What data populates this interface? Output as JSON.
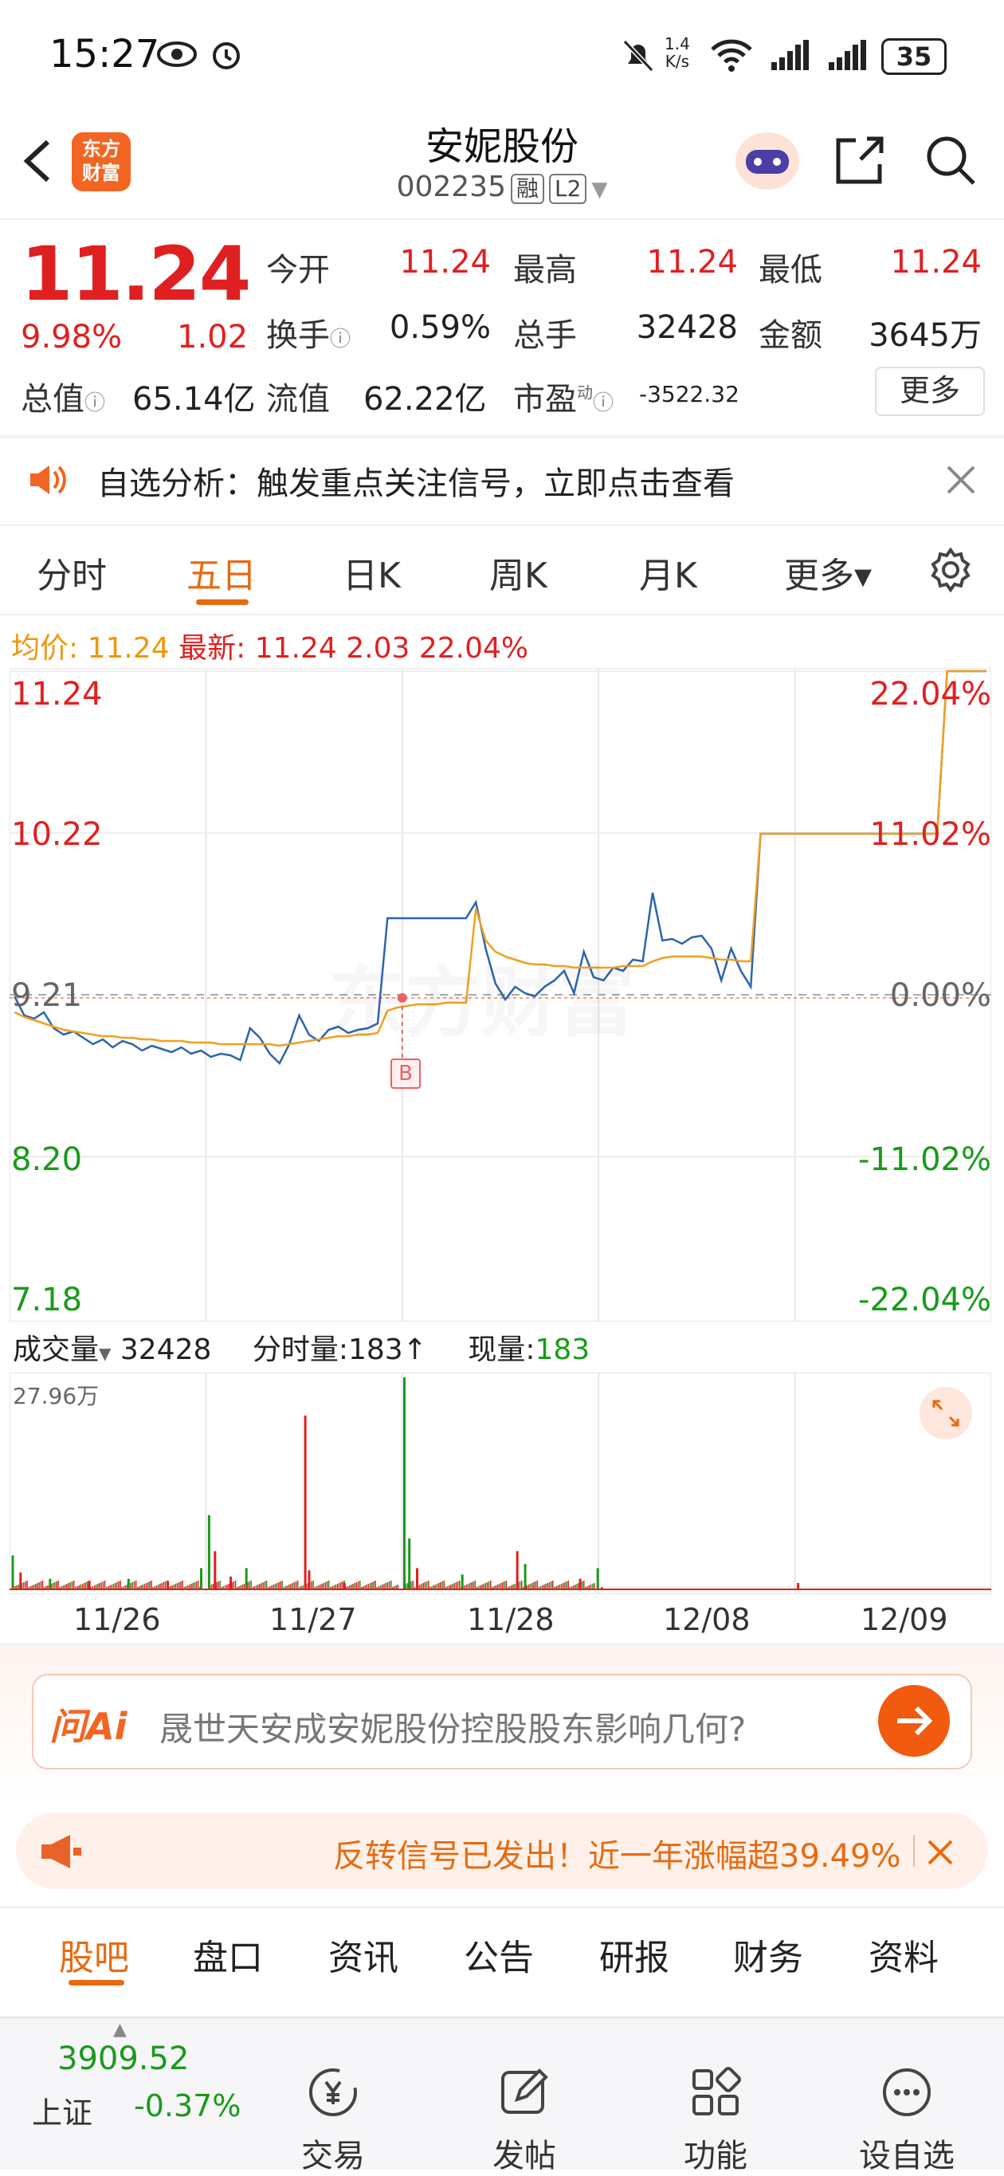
{
  "status_bar": {
    "time": "15:27",
    "net_speed_top": "1.4",
    "net_speed_bottom": "K/s",
    "battery": "35"
  },
  "header": {
    "logo_line1": "东方",
    "logo_line2": "财富",
    "title": "安妮股份",
    "code": "002235",
    "badge_rong": "融",
    "badge_l2": "L2"
  },
  "quote": {
    "price": "11.24",
    "change_pct": "9.98%",
    "change": "1.02",
    "open_label": "今开",
    "open": "11.24",
    "high_label": "最高",
    "high": "11.24",
    "low_label": "最低",
    "low": "11.24",
    "turnover_label": "换手",
    "turnover": "0.59%",
    "volume_label": "总手",
    "volume": "32428",
    "amount_label": "金额",
    "amount": "3645万",
    "mktcap_label": "总值",
    "mktcap": "65.14亿",
    "float_label": "流值",
    "float": "62.22亿",
    "pe_label": "市盈",
    "pe_sup": "动",
    "pe": "-3522.32",
    "more_label": "更多"
  },
  "notice": {
    "text": "自选分析：触发重点关注信号，立即点击查看"
  },
  "tabs": [
    "分时",
    "五日",
    "日K",
    "周K",
    "月K",
    "更多▾"
  ],
  "chart_info": {
    "avg_label": "均价:",
    "avg": "11.24",
    "latest_label": "最新:",
    "latest": "11.24",
    "chg": "2.03",
    "chg_pct": "22.04%"
  },
  "chart_data": {
    "type": "line",
    "title": "",
    "xlabel": "",
    "ylabel": "",
    "x": [
      "11/26",
      "11/27",
      "11/28",
      "12/08",
      "12/09"
    ],
    "ylim": [
      7.18,
      11.24
    ],
    "y_ticks_left": [
      "11.24",
      "10.22",
      "9.21",
      "8.20",
      "7.18"
    ],
    "y_ticks_right": [
      "22.04%",
      "11.02%",
      "0.00%",
      "-11.02%",
      "-22.04%"
    ],
    "prev_close": 9.21,
    "series": [
      {
        "values": [
          9.2,
          9.08,
          9.06,
          9.1,
          9.0,
          8.96,
          8.98,
          8.94,
          8.9,
          8.93,
          8.88,
          8.92,
          8.9,
          8.86,
          8.89,
          8.87,
          8.85,
          8.88,
          8.84,
          8.86,
          8.82,
          8.84,
          8.83,
          8.8,
          9.0,
          8.94,
          8.84,
          8.78,
          8.9,
          9.08,
          8.96,
          8.92,
          8.99,
          9.01,
          8.97,
          8.99,
          9.0,
          9.03,
          9.69,
          9.69,
          9.69,
          9.69,
          9.69,
          9.69,
          9.69,
          9.69,
          9.69,
          9.79,
          9.5,
          9.28,
          9.18,
          9.26,
          9.22,
          9.2,
          9.26,
          9.3,
          9.36,
          9.22,
          9.48,
          9.32,
          9.3,
          9.38,
          9.36,
          9.43,
          9.42,
          9.85,
          9.55,
          9.56,
          9.53,
          9.57,
          9.58,
          9.5,
          9.3,
          9.5,
          9.36,
          9.26,
          10.22,
          10.22,
          10.22,
          10.22,
          10.22,
          10.22,
          10.22,
          10.22,
          10.22,
          10.22,
          10.22,
          10.22,
          10.22,
          10.22,
          10.22,
          10.22,
          10.22,
          10.22,
          10.22,
          11.24,
          11.24,
          11.24,
          11.24,
          11.24
        ]
      },
      {
        "values": [
          9.1,
          9.07,
          9.05,
          9.03,
          9.01,
          8.99,
          8.98,
          8.97,
          8.96,
          8.95,
          8.95,
          8.94,
          8.94,
          8.93,
          8.93,
          8.92,
          8.92,
          8.92,
          8.91,
          8.91,
          8.91,
          8.9,
          8.9,
          8.9,
          8.9,
          8.9,
          8.9,
          8.89,
          8.9,
          8.91,
          8.92,
          8.93,
          8.94,
          8.95,
          8.95,
          8.96,
          8.96,
          8.97,
          9.11,
          9.13,
          9.14,
          9.15,
          9.15,
          9.15,
          9.16,
          9.16,
          9.16,
          9.75,
          9.55,
          9.48,
          9.45,
          9.43,
          9.41,
          9.4,
          9.4,
          9.39,
          9.39,
          9.38,
          9.38,
          9.38,
          9.38,
          9.38,
          9.39,
          9.39,
          9.39,
          9.42,
          9.44,
          9.45,
          9.45,
          9.45,
          9.45,
          9.44,
          9.43,
          9.43,
          9.42,
          9.42,
          10.22,
          10.22,
          10.22,
          10.22,
          10.22,
          10.22,
          10.22,
          10.22,
          10.22,
          10.22,
          10.22,
          10.22,
          10.22,
          10.22,
          10.22,
          10.22,
          10.22,
          10.22,
          10.22,
          11.24,
          11.24,
          11.24,
          11.24,
          11.24
        ]
      }
    ],
    "volume_max_label": "27.96万",
    "volume": [
      {
        "d": 0,
        "t": 0.01,
        "v": 0.16,
        "c": "green"
      },
      {
        "d": 0,
        "t": 0.05,
        "v": 0.08,
        "c": "red"
      },
      {
        "d": 0,
        "t": 0.2,
        "v": 0.05,
        "c": "green"
      },
      {
        "d": 0,
        "t": 0.4,
        "v": 0.04,
        "c": "red"
      },
      {
        "d": 0,
        "t": 0.6,
        "v": 0.05,
        "c": "green"
      },
      {
        "d": 0,
        "t": 0.8,
        "v": 0.04,
        "c": "red"
      },
      {
        "d": 0,
        "t": 0.97,
        "v": 0.1,
        "c": "green"
      },
      {
        "d": 1,
        "t": 0.01,
        "v": 0.35,
        "c": "green"
      },
      {
        "d": 1,
        "t": 0.04,
        "v": 0.18,
        "c": "red"
      },
      {
        "d": 1,
        "t": 0.12,
        "v": 0.06,
        "c": "red"
      },
      {
        "d": 1,
        "t": 0.2,
        "v": 0.1,
        "c": "green"
      },
      {
        "d": 1,
        "t": 0.5,
        "v": 0.82,
        "c": "red"
      },
      {
        "d": 1,
        "t": 0.52,
        "v": 0.09,
        "c": "red"
      },
      {
        "d": 1,
        "t": 0.7,
        "v": 0.03,
        "c": "red"
      },
      {
        "d": 2,
        "t": 0.005,
        "v": 1.0,
        "c": "green"
      },
      {
        "d": 2,
        "t": 0.03,
        "v": 0.24,
        "c": "green"
      },
      {
        "d": 2,
        "t": 0.07,
        "v": 0.1,
        "c": "red"
      },
      {
        "d": 2,
        "t": 0.3,
        "v": 0.07,
        "c": "green"
      },
      {
        "d": 2,
        "t": 0.58,
        "v": 0.18,
        "c": "red"
      },
      {
        "d": 2,
        "t": 0.62,
        "v": 0.12,
        "c": "green"
      },
      {
        "d": 2,
        "t": 0.9,
        "v": 0.05,
        "c": "red"
      },
      {
        "d": 2,
        "t": 0.99,
        "v": 0.1,
        "c": "green"
      },
      {
        "d": 3,
        "t": 0.01,
        "v": 0.01,
        "c": "red"
      },
      {
        "d": 4,
        "t": 0.01,
        "v": 0.03,
        "c": "red"
      }
    ]
  },
  "volume_info": {
    "label": "成交量",
    "total": "32428",
    "tick_label": "分时量:183↑",
    "now_label": "现量:",
    "now": "183"
  },
  "marker_b": "B",
  "watermark": "东方财富",
  "ai": {
    "logo": "问Ai",
    "question": "晟世天安成安妮股份控股股东影响几何?"
  },
  "banner": {
    "text": "反转信号已发出！近一年涨幅超39.49%"
  },
  "bottom_tabs": [
    "股吧",
    "盘口",
    "资讯",
    "公告",
    "研报",
    "财务",
    "资料"
  ],
  "nav": {
    "index_value": "3909.52",
    "index_name": "上证",
    "index_change": "-0.37%",
    "items": [
      "交易",
      "发帖",
      "功能",
      "设自选"
    ]
  },
  "colors": {
    "up": "#e02020",
    "down": "#1a9a1a",
    "accent": "#e86a10",
    "price_line": "#2d64b0",
    "avg_line": "#f0a020"
  }
}
